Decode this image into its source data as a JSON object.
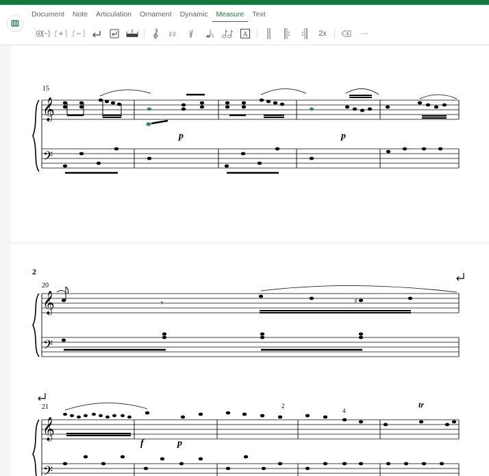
{
  "menu": {
    "items": [
      "Document",
      "Note",
      "Articulation",
      "Ornament",
      "Dynamic",
      "Measure",
      "Text"
    ],
    "active": "Measure"
  },
  "toolbar": {
    "speed_label": "2x",
    "more_label": "···",
    "text_tool_label": "A"
  },
  "score": {
    "system1_measure_number": "15",
    "system2_page_number": "2",
    "system2_measure_number": "20",
    "system3_measure_number": "21",
    "dynamic_p": "p",
    "dynamic_f": "f",
    "fingering_2": "2",
    "fingering_4": "4",
    "trill": "tr"
  },
  "colors": {
    "brand": "#157a3c",
    "selected_note": "#2e8b57"
  }
}
